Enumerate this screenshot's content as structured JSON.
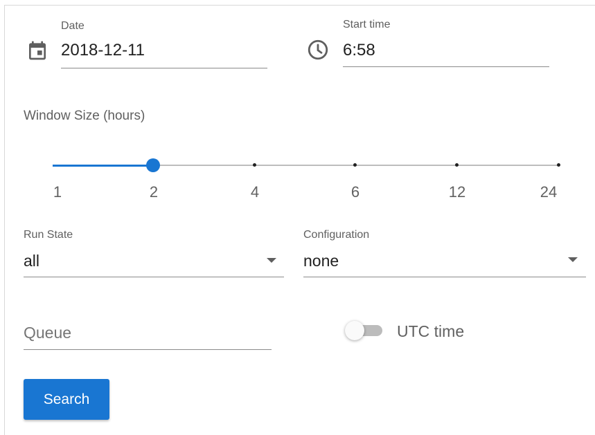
{
  "date": {
    "label": "Date",
    "value": "2018-12-11",
    "icon": "calendar-icon"
  },
  "start_time": {
    "label": "Start time",
    "value": "6:58",
    "icon": "clock-icon"
  },
  "window_size": {
    "label": "Window Size (hours)",
    "ticks": [
      "1",
      "2",
      "4",
      "6",
      "12",
      "24"
    ],
    "selected": "2"
  },
  "run_state": {
    "label": "Run State",
    "value": "all"
  },
  "configuration": {
    "label": "Configuration",
    "value": "none"
  },
  "queue": {
    "placeholder": "Queue"
  },
  "utc": {
    "label": "UTC time",
    "checked": false
  },
  "search_button": {
    "label": "Search"
  },
  "colors": {
    "accent": "#1976d2",
    "track": "#bdbdbd"
  }
}
